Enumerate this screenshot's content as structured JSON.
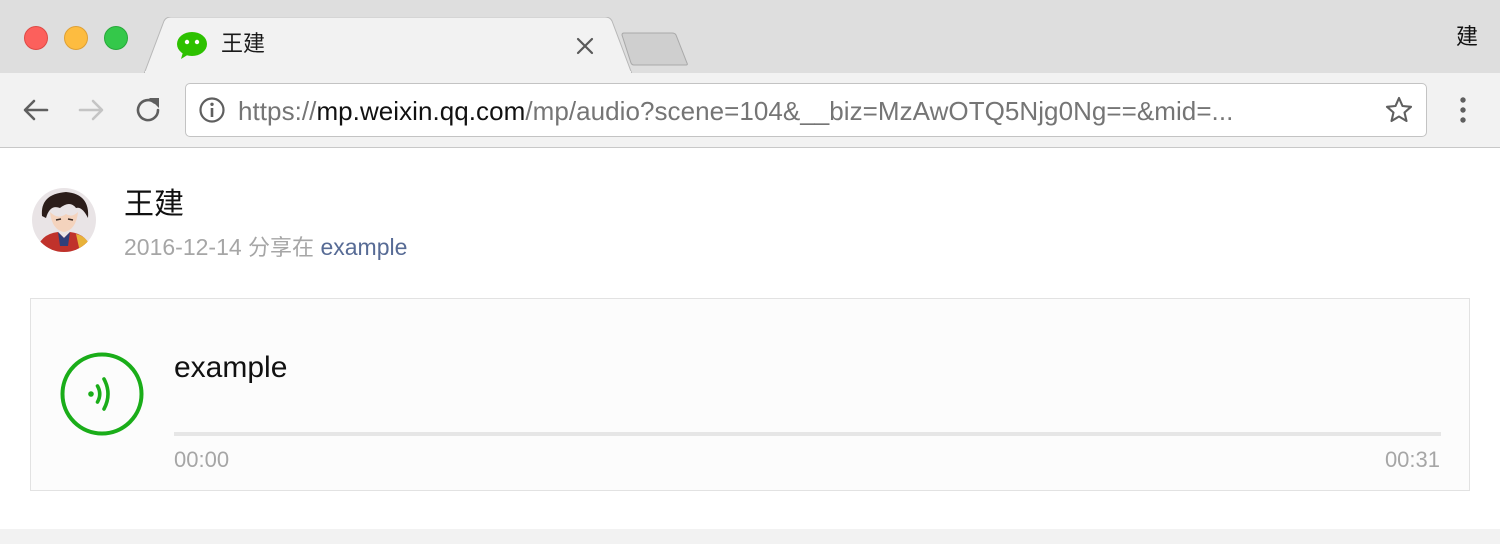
{
  "browser": {
    "tab": {
      "title": "王建",
      "favicon": "wechat-icon",
      "close_icon": "close-icon"
    },
    "new_tab_icon": "new-tab-icon",
    "profile_label": "建",
    "toolbar": {
      "back_icon": "back-arrow-icon",
      "forward_icon": "forward-arrow-icon",
      "reload_icon": "reload-icon",
      "info_icon": "info-icon",
      "url_scheme": "https://",
      "url_host": "mp.weixin.qq.com",
      "url_rest": "/mp/audio?scene=104&__biz=MzAwOTQ5Njg0Ng==&mid=...",
      "bookmark_icon": "star-icon",
      "menu_icon": "more-vertical-icon"
    }
  },
  "page": {
    "author": {
      "name": "王建",
      "avatar": "avatar"
    },
    "meta": {
      "date": "2016-12-14",
      "shared_in": "分享在",
      "source": "example"
    },
    "audio": {
      "title": "example",
      "current_time": "00:00",
      "duration": "00:31",
      "progress": 0,
      "play_icon": "audio-wave-icon"
    }
  },
  "colors": {
    "accent_green": "#1aad19",
    "link_blue": "#576b95",
    "muted_text": "#a6a6a6"
  }
}
